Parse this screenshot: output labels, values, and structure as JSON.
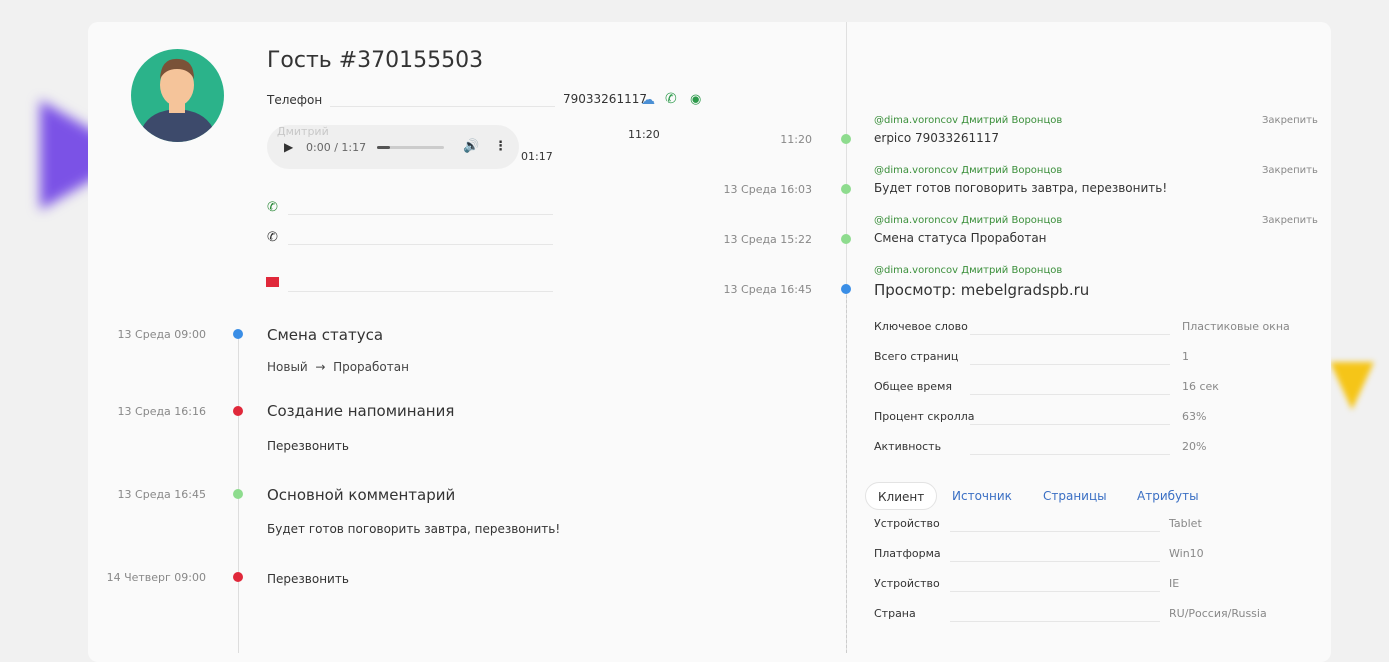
{
  "guest": {
    "title": "Гость #370155503",
    "phone_label": "Телефон",
    "phone_value": "79033261117"
  },
  "player": {
    "caller": "Дмитрий",
    "time": "0:00 / 1:17",
    "duration": "01:17",
    "call_time": "11:20",
    "progress": 0.2
  },
  "left_timeline": [
    {
      "date": "13 Среда 09:00",
      "title": "Смена статуса",
      "from": "Новый",
      "arrow": "→",
      "to": "Проработан",
      "color": "#3a8ee6"
    },
    {
      "date": "13 Среда 16:16",
      "title": "Создание напоминания",
      "text": "Перезвонить",
      "color": "#e0283a"
    },
    {
      "date": "13 Среда 16:45",
      "title": "Основной комментарий",
      "text": "Будет готов поговорить завтра, перезвонить!",
      "color": "#8edc8e"
    },
    {
      "date": "14 Четверг 09:00",
      "text": "Перезвонить",
      "color": "#e0283a"
    }
  ],
  "right_timeline": [
    {
      "date": "11:20",
      "author": "@dima.voroncov Дмитрий Воронцов",
      "text": "erpico 79033261117",
      "pin": "Закрепить"
    },
    {
      "date": "13 Среда 16:03",
      "author": "@dima.voroncov Дмитрий Воронцов",
      "text": "Будет готов поговорить завтра, перезвонить!",
      "pin": "Закрепить"
    },
    {
      "date": "13 Среда 15:22",
      "author": "@dima.voroncov Дмитрий Воронцов",
      "text": "Смена статуса Проработан",
      "pin": "Закрепить"
    },
    {
      "date": "13 Среда 16:45",
      "author": "@dima.voroncov Дмитрий Воронцов",
      "text": "Просмотр: mebelgradspb.ru"
    }
  ],
  "visit_stats": [
    {
      "label": "Ключевое слово",
      "value": "Пластиковые окна"
    },
    {
      "label": "Всего страниц",
      "value": "1"
    },
    {
      "label": "Общее время",
      "value": "16 сек"
    },
    {
      "label": "Процент скролла",
      "value": "63%"
    },
    {
      "label": "Активность",
      "value": "20%"
    }
  ],
  "tabs": [
    "Клиент",
    "Источник",
    "Страницы",
    "Атрибуты"
  ],
  "client": [
    {
      "label": "Устройство",
      "value": "Tablet"
    },
    {
      "label": "Платформа",
      "value": "Win10"
    },
    {
      "label": "Устройство",
      "value": "IE"
    },
    {
      "label": "Страна",
      "value": "RU/Россия/Russia"
    }
  ]
}
